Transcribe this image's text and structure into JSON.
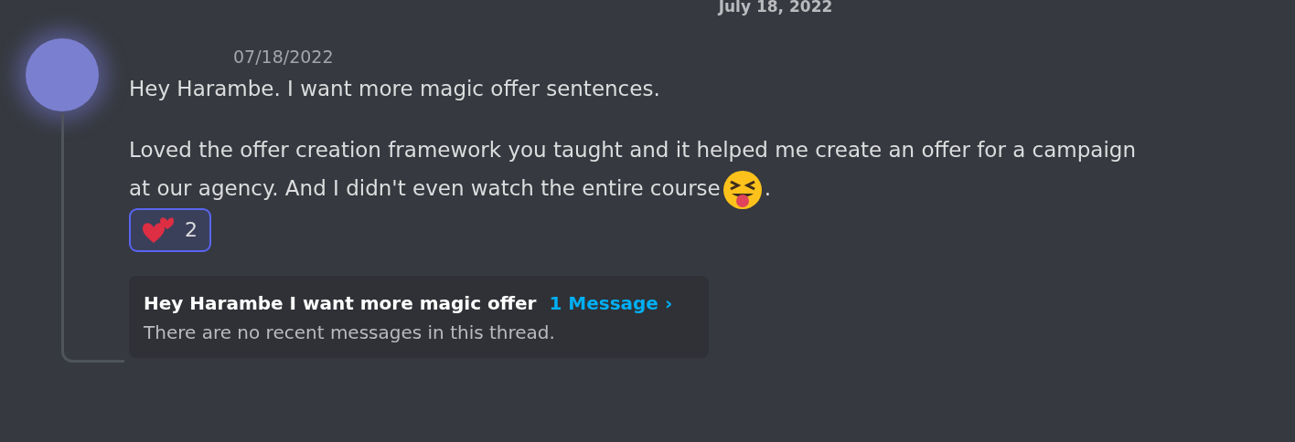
{
  "date_divider": "July 18, 2022",
  "message": {
    "timestamp": "07/18/2022",
    "paragraphs": [
      {
        "text": "Hey Harambe. I want more magic offer sentences."
      },
      {
        "text": "Loved the offer creation framework you taught and it helped me create an offer for a campaign at our agency. And I didn't even watch the entire course",
        "kind": "squint-tongue",
        "trailing": "."
      }
    ],
    "reactions": [
      {
        "kind": "two-hearts",
        "count": "2",
        "selected": true
      }
    ],
    "thread": {
      "title": "Hey Harambe I want more magic offer",
      "link": "1 Message ›",
      "preview": "There are no recent messages in this thread."
    }
  }
}
